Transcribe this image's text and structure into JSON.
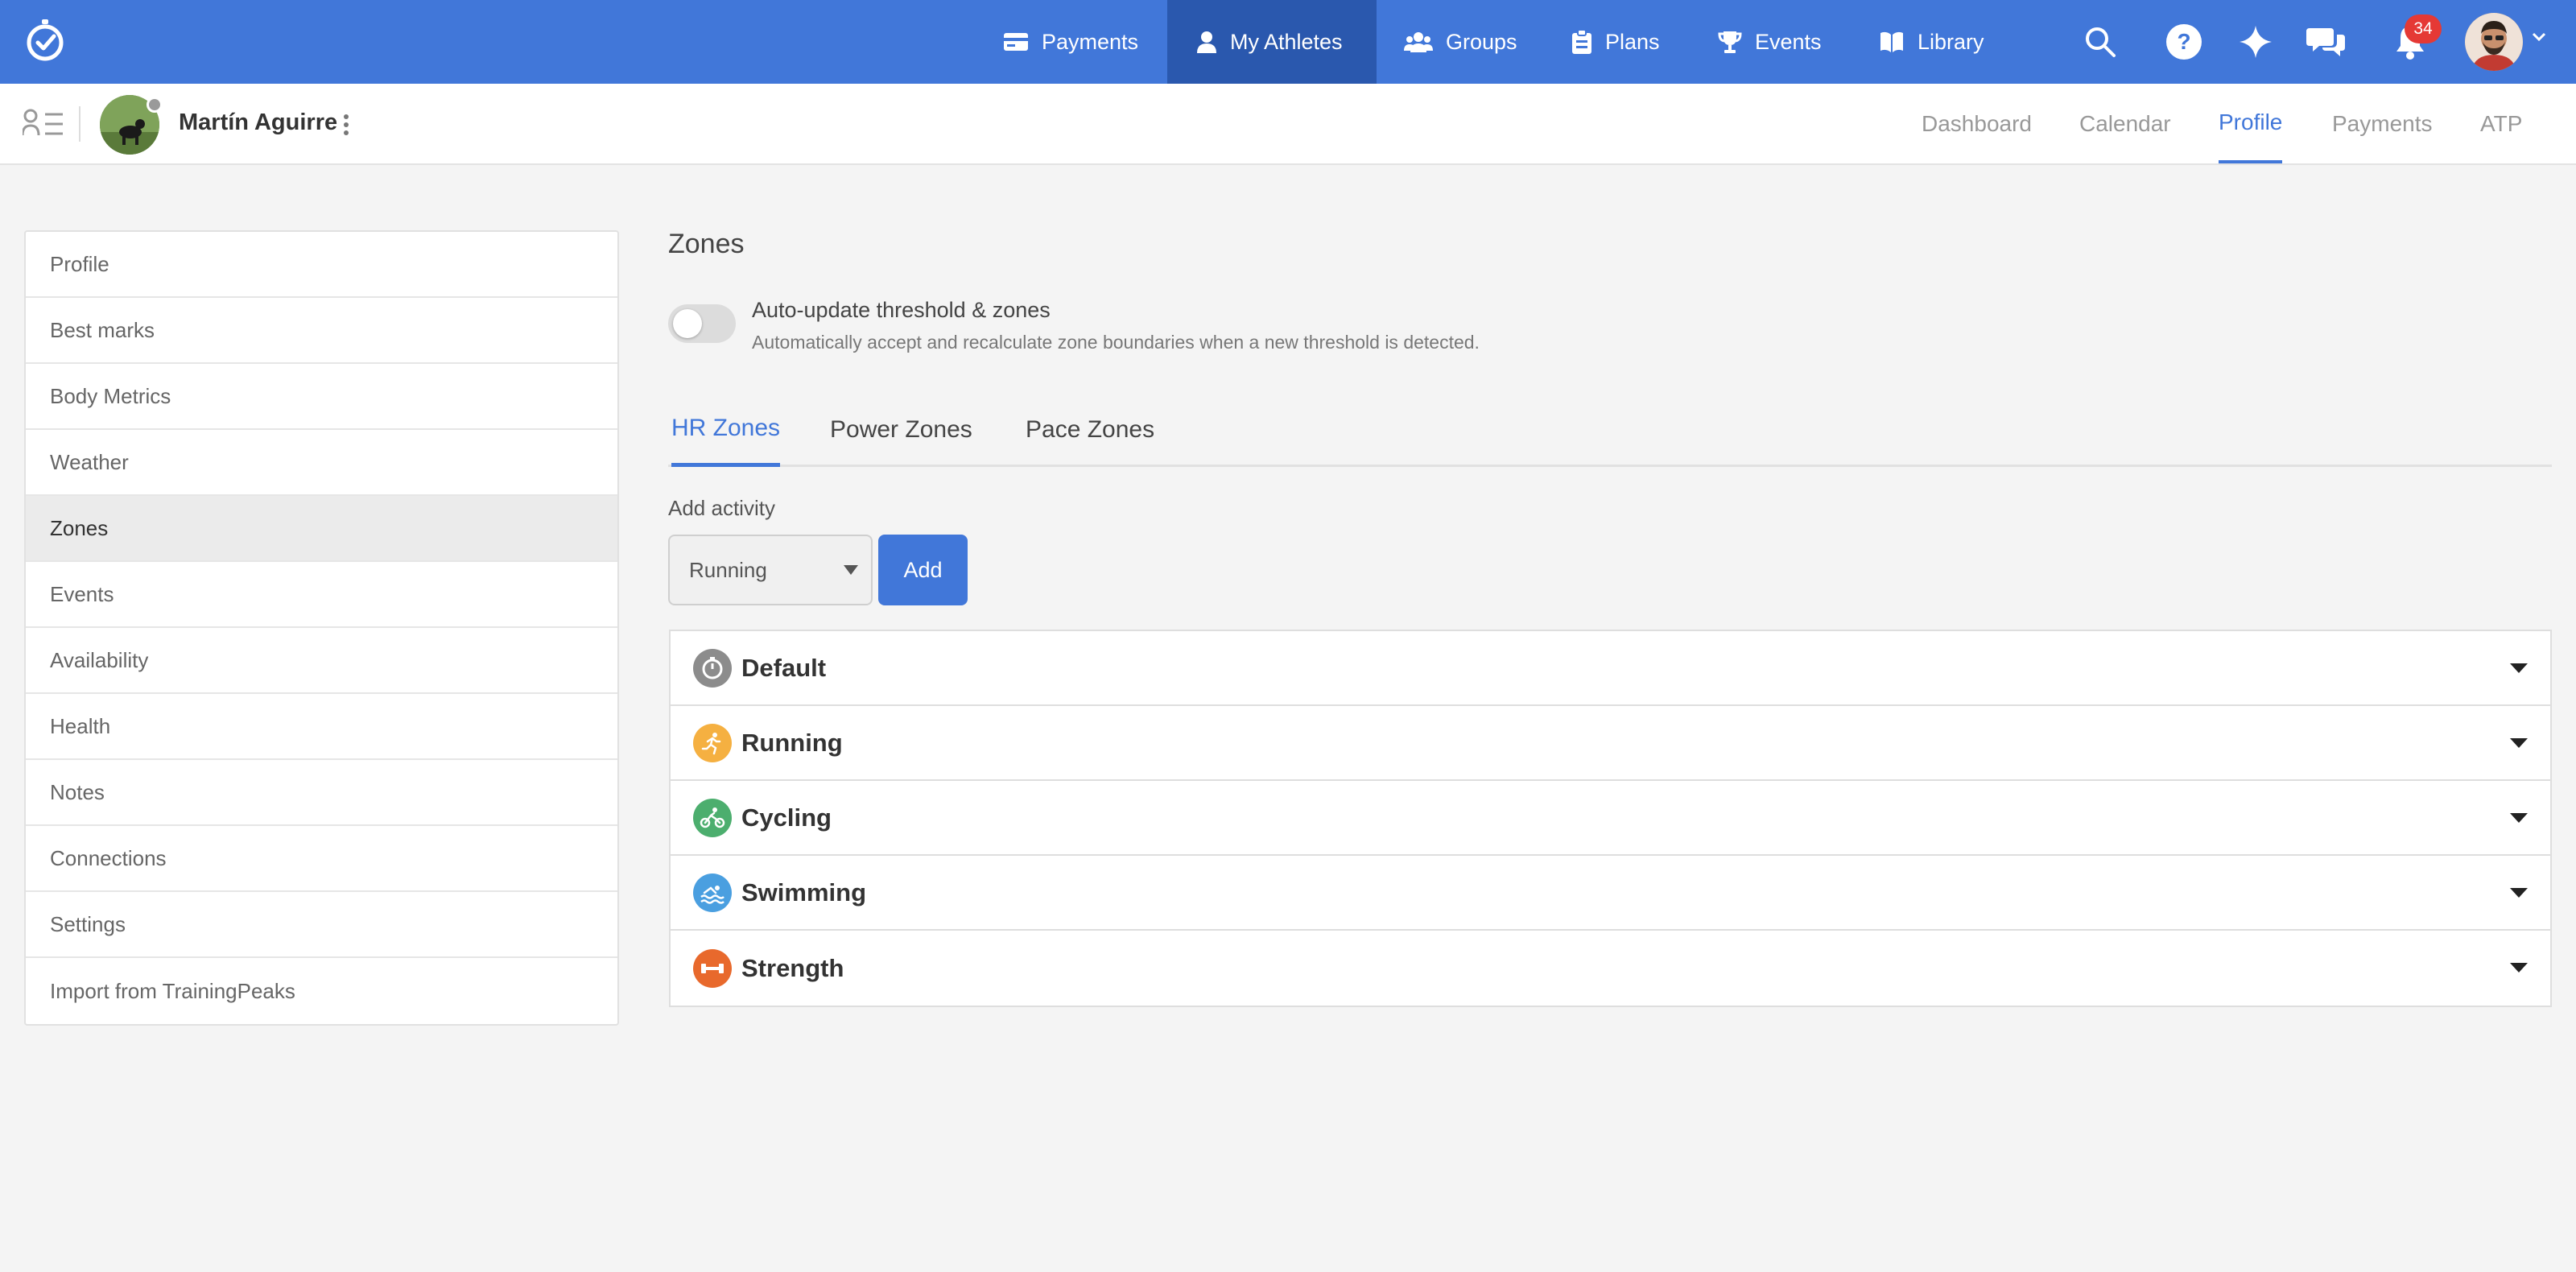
{
  "topnav": {
    "items": [
      {
        "label": "Payments",
        "icon": "card-icon"
      },
      {
        "label": "My Athletes",
        "icon": "person-icon"
      },
      {
        "label": "Groups",
        "icon": "group-icon"
      },
      {
        "label": "Plans",
        "icon": "clipboard-icon"
      },
      {
        "label": "Events",
        "icon": "trophy-icon"
      },
      {
        "label": "Library",
        "icon": "book-icon"
      }
    ],
    "active": "My Athletes",
    "notification_count": "34",
    "accent_color": "#4177d9",
    "active_color": "#2a58ae"
  },
  "athlete": {
    "name": "Martín Aguirre"
  },
  "subtabs": [
    "Dashboard",
    "Calendar",
    "Profile",
    "Payments",
    "ATP"
  ],
  "subtab_active": "Profile",
  "sidebar": {
    "items": [
      "Profile",
      "Best marks",
      "Body Metrics",
      "Weather",
      "Zones",
      "Events",
      "Availability",
      "Health",
      "Notes",
      "Connections",
      "Settings",
      "Import from TrainingPeaks"
    ],
    "active": "Zones"
  },
  "main": {
    "title": "Zones",
    "toggle": {
      "title": "Auto-update threshold & zones",
      "description": "Automatically accept and recalculate zone boundaries when a new threshold is detected.",
      "on": false
    },
    "tabs": [
      "HR Zones",
      "Power Zones",
      "Pace Zones"
    ],
    "tab_active": "HR Zones",
    "add_activity": {
      "label": "Add activity",
      "selected": "Running",
      "button": "Add"
    },
    "activities": [
      {
        "label": "Default",
        "icon": "stopwatch-icon",
        "color": "#8c8c8c"
      },
      {
        "label": "Running",
        "icon": "runner-icon",
        "color": "#f5b041"
      },
      {
        "label": "Cycling",
        "icon": "bike-icon",
        "color": "#4cae6e"
      },
      {
        "label": "Swimming",
        "icon": "swimmer-icon",
        "color": "#4a9fe0"
      },
      {
        "label": "Strength",
        "icon": "dumbbell-icon",
        "color": "#e8692c"
      }
    ]
  }
}
